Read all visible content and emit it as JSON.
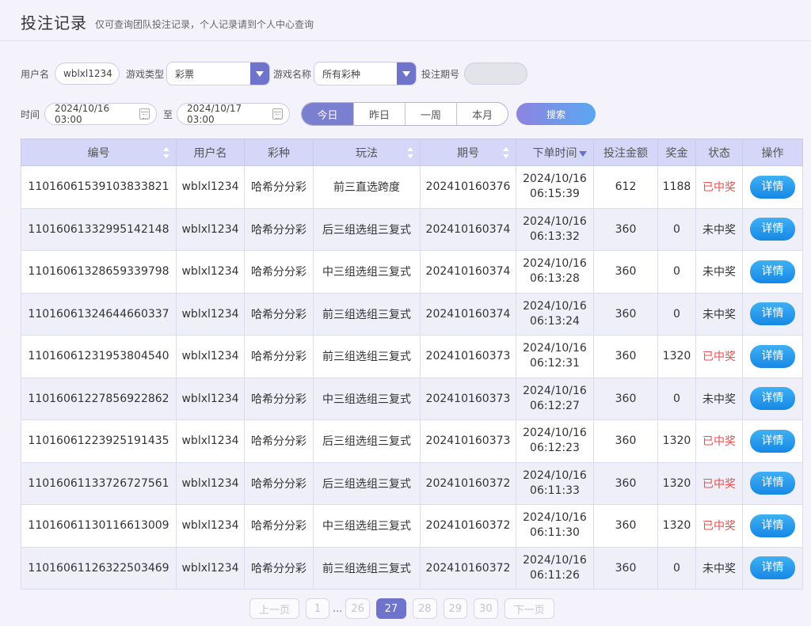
{
  "header": {
    "title": "投注记录",
    "subtitle": "仅可查询团队投注记录，个人记录请到个人中心查询"
  },
  "filters": {
    "username_label": "用户名",
    "username_value": "wblxl1234",
    "game_type_label": "游戏类型",
    "game_type_value": "彩票",
    "game_name_label": "游戏名称",
    "game_name_value": "所有彩种",
    "issue_label": "投注期号",
    "issue_value": "",
    "time_label": "时间",
    "start_time": "2024/10/16 03:00",
    "to_label": "至",
    "end_time": "2024/10/17 03:00",
    "quick_ranges": [
      "今日",
      "昨日",
      "一周",
      "本月"
    ],
    "active_range": "今日",
    "search_label": "搜索"
  },
  "table": {
    "columns": [
      "编号",
      "用户名",
      "彩种",
      "玩法",
      "期号",
      "下单时间",
      "投注金额",
      "奖金",
      "状态",
      "操作"
    ],
    "rows": [
      {
        "id": "11016061539103833821",
        "user": "wblxl1234",
        "lottery": "哈希分分彩",
        "play": "前三直选跨度",
        "issue": "202410160376",
        "date": "2024/10/16",
        "time": "06:15:39",
        "amount": "612",
        "prize": "1188",
        "status": "已中奖",
        "action": "详情"
      },
      {
        "id": "11016061332995142148",
        "user": "wblxl1234",
        "lottery": "哈希分分彩",
        "play": "后三组选组三复式",
        "issue": "202410160374",
        "date": "2024/10/16",
        "time": "06:13:32",
        "amount": "360",
        "prize": "0",
        "status": "未中奖",
        "action": "详情"
      },
      {
        "id": "11016061328659339798",
        "user": "wblxl1234",
        "lottery": "哈希分分彩",
        "play": "中三组选组三复式",
        "issue": "202410160374",
        "date": "2024/10/16",
        "time": "06:13:28",
        "amount": "360",
        "prize": "0",
        "status": "未中奖",
        "action": "详情"
      },
      {
        "id": "11016061324644660337",
        "user": "wblxl1234",
        "lottery": "哈希分分彩",
        "play": "前三组选组三复式",
        "issue": "202410160374",
        "date": "2024/10/16",
        "time": "06:13:24",
        "amount": "360",
        "prize": "0",
        "status": "未中奖",
        "action": "详情"
      },
      {
        "id": "11016061231953804540",
        "user": "wblxl1234",
        "lottery": "哈希分分彩",
        "play": "前三组选组三复式",
        "issue": "202410160373",
        "date": "2024/10/16",
        "time": "06:12:31",
        "amount": "360",
        "prize": "1320",
        "status": "已中奖",
        "action": "详情"
      },
      {
        "id": "11016061227856922862",
        "user": "wblxl1234",
        "lottery": "哈希分分彩",
        "play": "中三组选组三复式",
        "issue": "202410160373",
        "date": "2024/10/16",
        "time": "06:12:27",
        "amount": "360",
        "prize": "0",
        "status": "未中奖",
        "action": "详情"
      },
      {
        "id": "11016061223925191435",
        "user": "wblxl1234",
        "lottery": "哈希分分彩",
        "play": "后三组选组三复式",
        "issue": "202410160373",
        "date": "2024/10/16",
        "time": "06:12:23",
        "amount": "360",
        "prize": "1320",
        "status": "已中奖",
        "action": "详情"
      },
      {
        "id": "11016061133726727561",
        "user": "wblxl1234",
        "lottery": "哈希分分彩",
        "play": "后三组选组三复式",
        "issue": "202410160372",
        "date": "2024/10/16",
        "time": "06:11:33",
        "amount": "360",
        "prize": "1320",
        "status": "已中奖",
        "action": "详情"
      },
      {
        "id": "11016061130116613009",
        "user": "wblxl1234",
        "lottery": "哈希分分彩",
        "play": "中三组选组三复式",
        "issue": "202410160372",
        "date": "2024/10/16",
        "time": "06:11:30",
        "amount": "360",
        "prize": "1320",
        "status": "已中奖",
        "action": "详情"
      },
      {
        "id": "11016061126322503469",
        "user": "wblxl1234",
        "lottery": "哈希分分彩",
        "play": "前三组选组三复式",
        "issue": "202410160372",
        "date": "2024/10/16",
        "time": "06:11:26",
        "amount": "360",
        "prize": "0",
        "status": "未中奖",
        "action": "详情"
      }
    ]
  },
  "pagination": {
    "prev": "上一页",
    "first": "1",
    "ellipsis": "...",
    "pages": [
      "26",
      "27",
      "28",
      "29",
      "30"
    ],
    "current": "27",
    "next": "下一页"
  },
  "colors": {
    "accent": "#6e73cc",
    "win": "#f04a4a",
    "detail_button": "#1688e4"
  }
}
